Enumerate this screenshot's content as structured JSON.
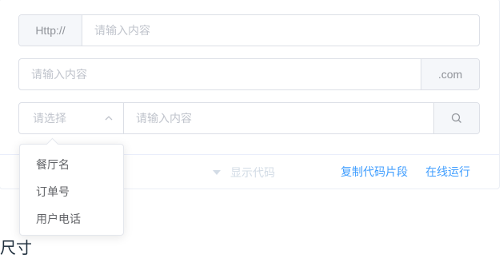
{
  "inputs": {
    "row1": {
      "prepend": "Http://",
      "placeholder": "请输入内容"
    },
    "row2": {
      "placeholder": "请输入内容",
      "append": ".com"
    },
    "row3": {
      "select_placeholder": "请选择",
      "placeholder": "请输入内容"
    }
  },
  "dropdown": {
    "options": [
      "餐厅名",
      "订单号",
      "用户电话"
    ]
  },
  "footer": {
    "show_code": "显示代码",
    "copy_code": "复制代码片段",
    "run_online": "在线运行"
  },
  "section_heading": "尺寸",
  "colors": {
    "link": "#409eff",
    "border": "#dcdfe6",
    "addon_bg": "#f5f7fa",
    "placeholder": "#c0c4cc"
  }
}
